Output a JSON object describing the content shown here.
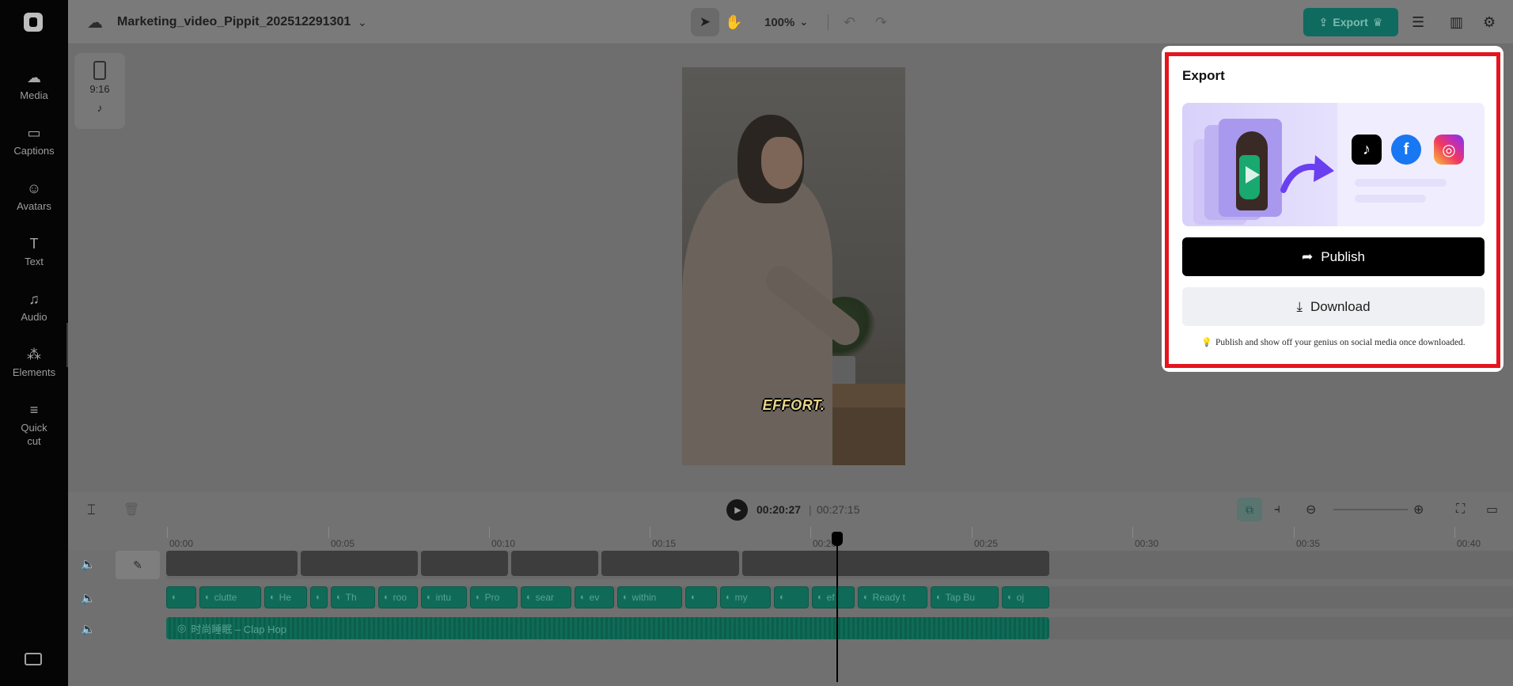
{
  "sidebar": {
    "items": [
      {
        "label": "Media",
        "icon": "upload-cloud-icon",
        "glyph": "☁"
      },
      {
        "label": "Captions",
        "icon": "captions-icon",
        "glyph": "▭"
      },
      {
        "label": "Avatars",
        "icon": "avatar-icon",
        "glyph": "☺"
      },
      {
        "label": "Text",
        "icon": "text-icon",
        "glyph": "T"
      },
      {
        "label": "Audio",
        "icon": "music-note-icon",
        "glyph": "♫"
      },
      {
        "label": "Elements",
        "icon": "elements-icon",
        "glyph": "⁂"
      },
      {
        "label": "Quick cut",
        "icon": "quick-cut-icon",
        "glyph": "≡"
      }
    ]
  },
  "topbar": {
    "project_title": "Marketing_video_Pippit_202512291301",
    "zoom": "100%",
    "export_label": "Export"
  },
  "ratio": {
    "label": "9:16"
  },
  "preview": {
    "caption": "EFFORT."
  },
  "timeline": {
    "current_time": "00:20:27",
    "separator": "|",
    "total_time": "00:27:15",
    "ticks": [
      "00:00",
      "00:05",
      "00:10",
      "00:15",
      "00:20",
      "00:25",
      "00:30",
      "00:35",
      "00:40"
    ],
    "caption_clips": [
      "",
      "clutte",
      "He",
      "",
      "Th",
      "roo",
      "intu",
      "Pro",
      "sear",
      "ev",
      "within",
      "",
      "my",
      "",
      "ef",
      "Ready t",
      "Tap Bu",
      "oj"
    ],
    "audio_clip_label": "时尚睡眠 – Clap Hop"
  },
  "export_panel": {
    "title": "Export",
    "publish_label": "Publish",
    "download_label": "Download",
    "tip": "Publish and show off your genius on social media once downloaded."
  },
  "colors": {
    "accent": "#0f6b60",
    "highlight": "#e5141e",
    "publish_bg": "#000000"
  }
}
